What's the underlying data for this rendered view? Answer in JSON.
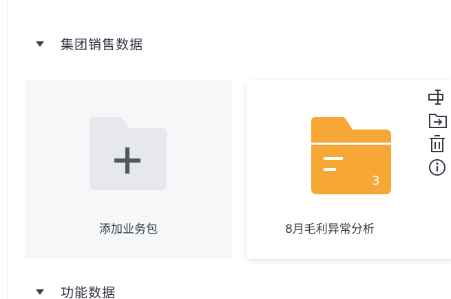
{
  "sections": [
    {
      "title": "集团销售数据"
    },
    {
      "title": "功能数据"
    }
  ],
  "cards": {
    "add": {
      "label": "添加业务包"
    },
    "folder": {
      "label": "8月毛利异常分析",
      "count": "3"
    }
  },
  "actions": [
    {
      "name": "rename-icon"
    },
    {
      "name": "move-icon"
    },
    {
      "name": "delete-icon"
    },
    {
      "name": "info-icon"
    }
  ],
  "colors": {
    "folder": "#f7a736",
    "add_folder": "#e6e8ec",
    "plus": "#4f5664",
    "icon_stroke": "#333a45"
  }
}
